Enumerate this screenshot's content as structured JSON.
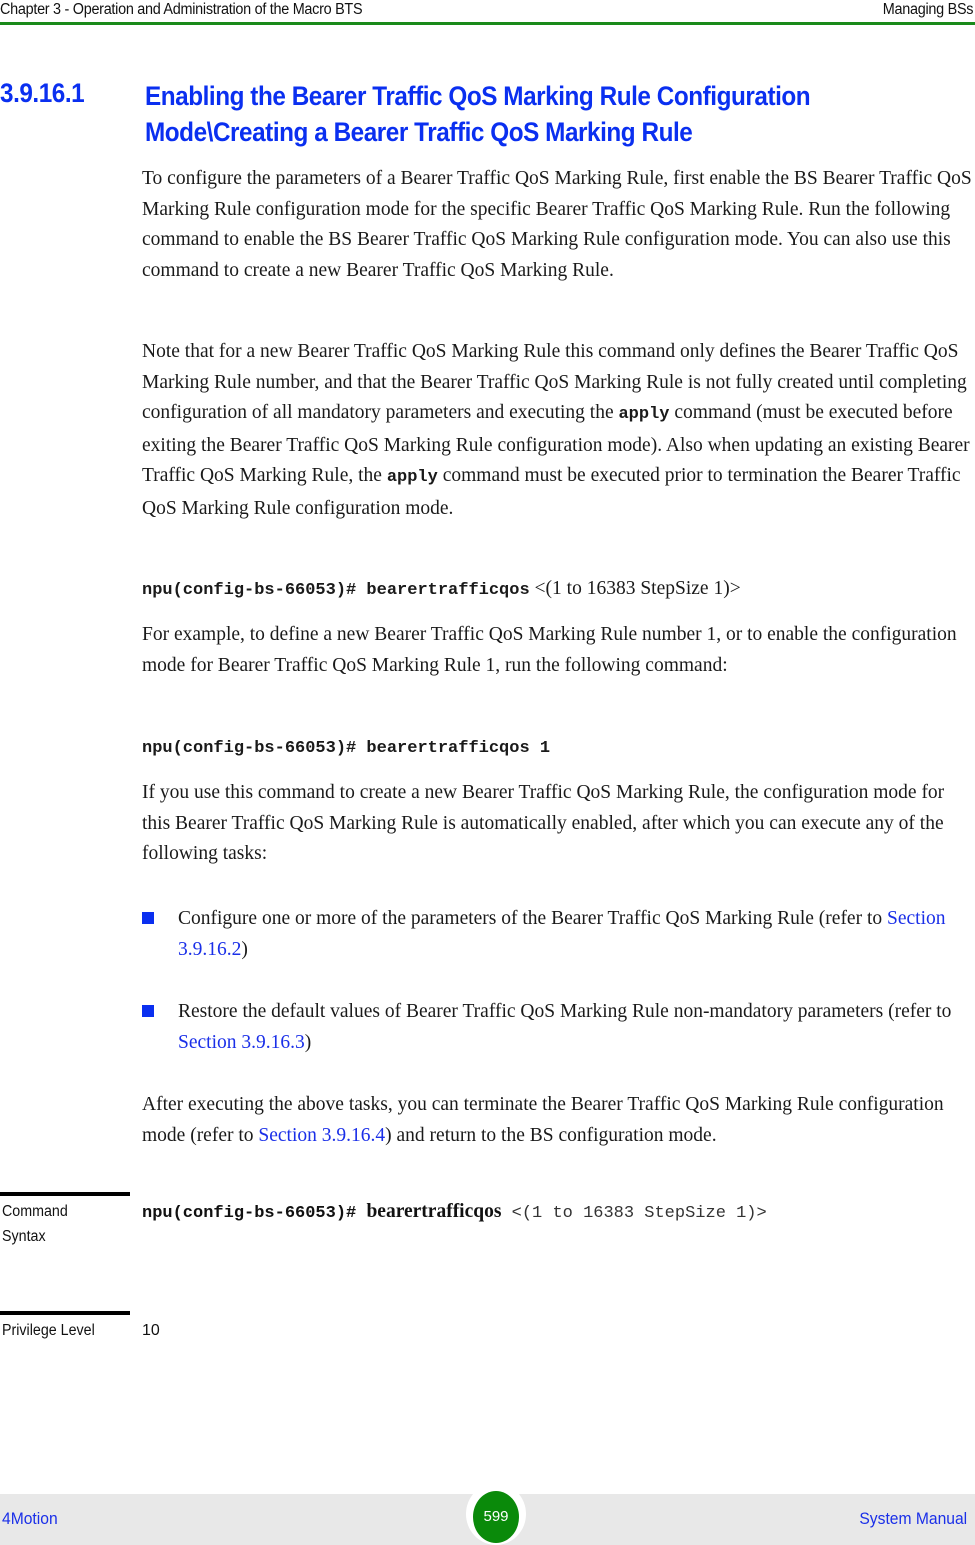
{
  "header": {
    "chapter": "Chapter 3 - Operation and Administration of the Macro BTS",
    "section": "Managing BSs"
  },
  "section": {
    "number": "3.9.16.1",
    "title": "Enabling the Bearer Traffic QoS Marking Rule Configuration Mode\\Creating a Bearer Traffic QoS Marking Rule"
  },
  "paragraphs": {
    "p1": "To configure the parameters of a Bearer Traffic QoS Marking Rule, first enable the BS Bearer Traffic QoS Marking Rule configuration mode for the specific Bearer Traffic QoS Marking Rule. Run the following command to enable the BS Bearer Traffic QoS Marking Rule configuration mode. You can also use this command to create a new Bearer Traffic QoS Marking Rule.",
    "p2_a": "Note that for a new Bearer Traffic QoS Marking Rule this command only defines the Bearer Traffic QoS Marking Rule number, and that the Bearer Traffic QoS Marking Rule is not fully created until completing configuration of all mandatory parameters and executing the ",
    "p2_bold1": "apply",
    "p2_b": " command (must be executed before exiting the Bearer Traffic QoS Marking Rule configuration mode). Also when updating an existing Bearer Traffic QoS Marking Rule, the ",
    "p2_bold2": "apply",
    "p2_c": " command must be executed prior to termination the Bearer Traffic QoS Marking Rule configuration mode.",
    "cmd1_prefix": "npu(config-bs-66053)# bearertrafficqos",
    "cmd1_arg": " <(1 to 16383 StepSize 1)>",
    "p3": "For example, to define a new Bearer Traffic QoS Marking Rule number 1, or to enable the configuration mode for Bearer Traffic QoS Marking Rule 1, run the following command:",
    "cmd2": "npu(config-bs-66053)# bearertrafficqos 1",
    "p4": "If you use this command to create a new Bearer Traffic QoS Marking Rule, the configuration mode for this Bearer Traffic QoS Marking Rule is automatically enabled, after which you can execute any of the following tasks:",
    "p5_a": "After executing the above tasks, you can terminate the Bearer Traffic QoS Marking Rule configuration mode (refer to ",
    "p5_link": "Section 3.9.16.4",
    "p5_b": ") and return to the BS configuration mode."
  },
  "bullets": [
    {
      "text_a": "Configure one or more of the parameters of the Bearer Traffic QoS Marking Rule (refer to ",
      "link": "Section 3.9.16.2",
      "text_b": ")"
    },
    {
      "text_a": "Restore the default values of Bearer Traffic QoS Marking Rule non-mandatory parameters (refer to ",
      "link": "Section 3.9.16.3",
      "text_b": ")"
    }
  ],
  "command_syntax": {
    "label": "Command Syntax",
    "prefix": "npu(config-bs-66053)# ",
    "keyword": "bearertrafficqos",
    "argument": " <(1 to 16383 StepSize 1)>"
  },
  "privilege_level": {
    "label": "Privilege Level",
    "value": "10"
  },
  "footer": {
    "product": "4Motion",
    "page_number": "599",
    "doc_name": "System Manual"
  },
  "colors": {
    "heading_blue": "#0a2ff0",
    "link_blue": "#1a2fe8",
    "header_rule_green": "#1a8a1a",
    "page_badge_green": "#0a8a0a"
  }
}
